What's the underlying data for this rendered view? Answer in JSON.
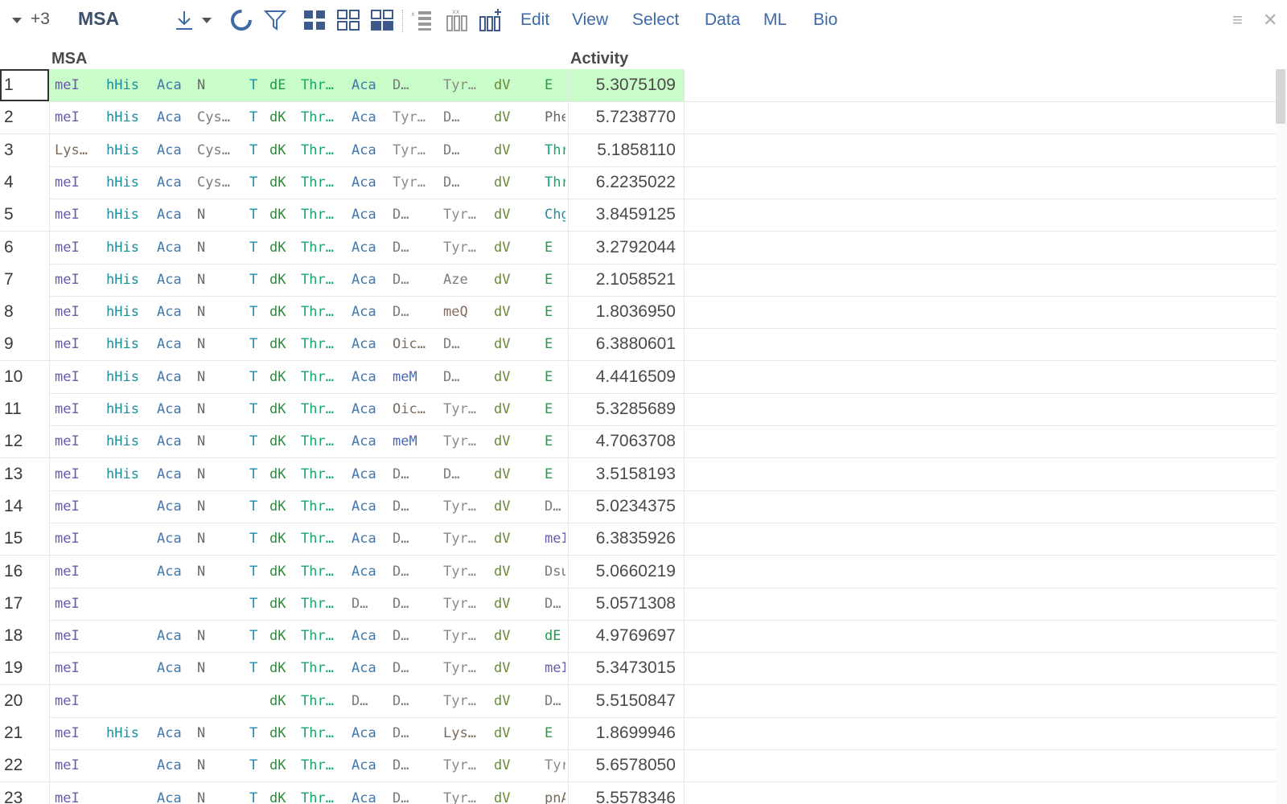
{
  "toolbar": {
    "counter": "+3",
    "title": "MSA",
    "menu": [
      "Edit",
      "View",
      "Select",
      "Data",
      "ML",
      "Bio"
    ],
    "icons": [
      "download-icon",
      "refresh-icon",
      "filter-icon",
      "grid-icon",
      "grid-outline-icon",
      "grid-mixed-icon",
      "list-icon",
      "columns-icon",
      "add-column-icon"
    ]
  },
  "window": {
    "menu_icon": "≡",
    "close_icon": "✕"
  },
  "table": {
    "headers": {
      "msa": "MSA",
      "activity": "Activity"
    },
    "selected_row": 0,
    "rows": [
      {
        "num": "1",
        "m": [
          "meI",
          "hHis",
          "Aca",
          "N",
          "T",
          "dE",
          "Thr…",
          "Aca",
          "D…",
          "Tyr…",
          "dV",
          "E"
        ],
        "activity": "5.3075109"
      },
      {
        "num": "2",
        "m": [
          "meI",
          "hHis",
          "Aca",
          "Cys…",
          "T",
          "dK",
          "Thr…",
          "Aca",
          "Tyr…",
          "D…",
          "dV",
          "Phe"
        ],
        "activity": "5.7238770"
      },
      {
        "num": "3",
        "m": [
          "Lys…",
          "hHis",
          "Aca",
          "Cys…",
          "T",
          "dK",
          "Thr…",
          "Aca",
          "Tyr…",
          "D…",
          "dV",
          "Thr"
        ],
        "activity": "5.1858110"
      },
      {
        "num": "4",
        "m": [
          "meI",
          "hHis",
          "Aca",
          "Cys…",
          "T",
          "dK",
          "Thr…",
          "Aca",
          "Tyr…",
          "D…",
          "dV",
          "Thr"
        ],
        "activity": "6.2235022"
      },
      {
        "num": "5",
        "m": [
          "meI",
          "hHis",
          "Aca",
          "N",
          "T",
          "dK",
          "Thr…",
          "Aca",
          "D…",
          "Tyr…",
          "dV",
          "Chg"
        ],
        "activity": "3.8459125"
      },
      {
        "num": "6",
        "m": [
          "meI",
          "hHis",
          "Aca",
          "N",
          "T",
          "dK",
          "Thr…",
          "Aca",
          "D…",
          "Tyr…",
          "dV",
          "E"
        ],
        "activity": "3.2792044"
      },
      {
        "num": "7",
        "m": [
          "meI",
          "hHis",
          "Aca",
          "N",
          "T",
          "dK",
          "Thr…",
          "Aca",
          "D…",
          "Aze",
          "dV",
          "E"
        ],
        "activity": "2.1058521"
      },
      {
        "num": "8",
        "m": [
          "meI",
          "hHis",
          "Aca",
          "N",
          "T",
          "dK",
          "Thr…",
          "Aca",
          "D…",
          "meQ",
          "dV",
          "E"
        ],
        "activity": "1.8036950"
      },
      {
        "num": "9",
        "m": [
          "meI",
          "hHis",
          "Aca",
          "N",
          "T",
          "dK",
          "Thr…",
          "Aca",
          "Oic…",
          "D…",
          "dV",
          "E"
        ],
        "activity": "6.3880601"
      },
      {
        "num": "10",
        "m": [
          "meI",
          "hHis",
          "Aca",
          "N",
          "T",
          "dK",
          "Thr…",
          "Aca",
          "meM",
          "D…",
          "dV",
          "E"
        ],
        "activity": "4.4416509"
      },
      {
        "num": "11",
        "m": [
          "meI",
          "hHis",
          "Aca",
          "N",
          "T",
          "dK",
          "Thr…",
          "Aca",
          "Oic…",
          "Tyr…",
          "dV",
          "E"
        ],
        "activity": "5.3285689"
      },
      {
        "num": "12",
        "m": [
          "meI",
          "hHis",
          "Aca",
          "N",
          "T",
          "dK",
          "Thr…",
          "Aca",
          "meM",
          "Tyr…",
          "dV",
          "E"
        ],
        "activity": "4.7063708"
      },
      {
        "num": "13",
        "m": [
          "meI",
          "hHis",
          "Aca",
          "N",
          "T",
          "dK",
          "Thr…",
          "Aca",
          "D…",
          "D…",
          "dV",
          "E"
        ],
        "activity": "3.5158193"
      },
      {
        "num": "14",
        "m": [
          "meI",
          "",
          "Aca",
          "N",
          "T",
          "dK",
          "Thr…",
          "Aca",
          "D…",
          "Tyr…",
          "dV",
          "D…"
        ],
        "activity": "5.0234375"
      },
      {
        "num": "15",
        "m": [
          "meI",
          "",
          "Aca",
          "N",
          "T",
          "dK",
          "Thr…",
          "Aca",
          "D…",
          "Tyr…",
          "dV",
          "meI"
        ],
        "activity": "6.3835926"
      },
      {
        "num": "16",
        "m": [
          "meI",
          "",
          "Aca",
          "N",
          "T",
          "dK",
          "Thr…",
          "Aca",
          "D…",
          "Tyr…",
          "dV",
          "Dsu"
        ],
        "activity": "5.0660219"
      },
      {
        "num": "17",
        "m": [
          "meI",
          "",
          "",
          "",
          "T",
          "dK",
          "Thr…",
          "D…",
          "D…",
          "Tyr…",
          "dV",
          "D…"
        ],
        "activity": "5.0571308"
      },
      {
        "num": "18",
        "m": [
          "meI",
          "",
          "Aca",
          "N",
          "T",
          "dK",
          "Thr…",
          "Aca",
          "D…",
          "Tyr…",
          "dV",
          "dE"
        ],
        "activity": "4.9769697"
      },
      {
        "num": "19",
        "m": [
          "meI",
          "",
          "Aca",
          "N",
          "T",
          "dK",
          "Thr…",
          "Aca",
          "D…",
          "Tyr…",
          "dV",
          "meI"
        ],
        "activity": "5.3473015"
      },
      {
        "num": "20",
        "m": [
          "meI",
          "",
          "",
          "",
          "",
          "dK",
          "Thr…",
          "D…",
          "D…",
          "Tyr…",
          "dV",
          "D…"
        ],
        "activity": "5.5150847"
      },
      {
        "num": "21",
        "m": [
          "meI",
          "hHis",
          "Aca",
          "N",
          "T",
          "dK",
          "Thr…",
          "Aca",
          "D…",
          "Lys…",
          "dV",
          "E"
        ],
        "activity": "1.8699946"
      },
      {
        "num": "22",
        "m": [
          "meI",
          "",
          "Aca",
          "N",
          "T",
          "dK",
          "Thr…",
          "Aca",
          "D…",
          "Tyr…",
          "dV",
          "Tyr"
        ],
        "activity": "5.6578050"
      },
      {
        "num": "23",
        "m": [
          "meI",
          "",
          "Aca",
          "N",
          "T",
          "dK",
          "Thr…",
          "Aca",
          "D…",
          "Tyr…",
          "dV",
          "pnA"
        ],
        "activity": "5.5578346"
      }
    ]
  },
  "colors": {
    "selected_row_bg": "#c8fcc8",
    "menu_text": "#3e6aa8",
    "title_text": "#3d4f6b"
  }
}
